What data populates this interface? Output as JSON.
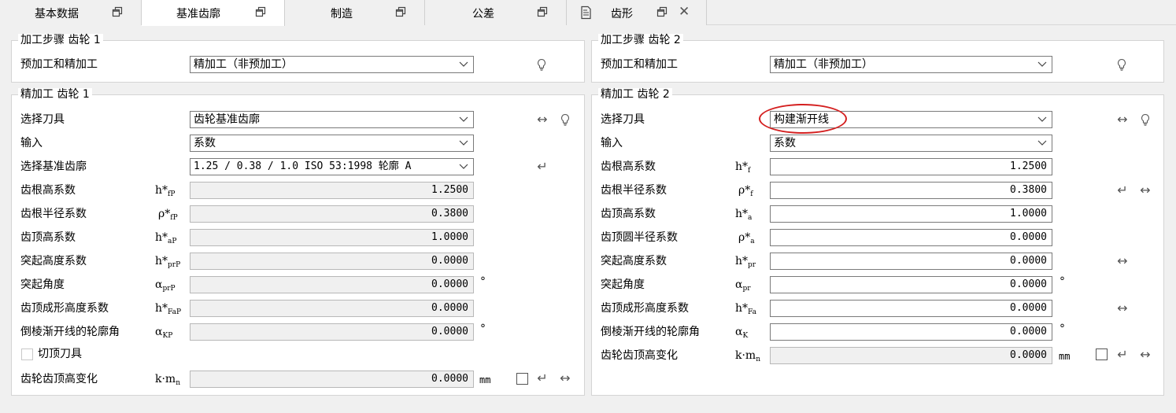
{
  "tabs": [
    {
      "label": "基本数据"
    },
    {
      "label": "基准齿廓"
    },
    {
      "label": "制造"
    },
    {
      "label": "公差"
    },
    {
      "label": "齿形"
    }
  ],
  "left": {
    "step_title": "加工步骤 齿轮 1",
    "step_label": "预加工和精加工",
    "step_value": "精加工（非预加工）",
    "finish_title": "精加工 齿轮 1",
    "tool_label": "选择刀具",
    "tool_value": "齿轮基准齿廓",
    "input_label": "输入",
    "input_value": "系数",
    "profile_label": "选择基准齿廓",
    "profile_value": "1.25 / 0.38 / 1.0 ISO 53:1998 轮廓 A",
    "rows": [
      {
        "label": "齿根高系数",
        "sym": "h*",
        "sub": "fP",
        "value": "1.2500"
      },
      {
        "label": "齿根半径系数",
        "sym": "ρ*",
        "sub": "fP",
        "value": "0.3800"
      },
      {
        "label": "齿顶高系数",
        "sym": "h*",
        "sub": "aP",
        "value": "1.0000"
      },
      {
        "label": "突起高度系数",
        "sym": "h*",
        "sub": "prP",
        "value": "0.0000"
      },
      {
        "label": "突起角度",
        "sym": "α",
        "sub": "prP",
        "value": "0.0000"
      },
      {
        "label": "齿顶成形高度系数",
        "sym": "h*",
        "sub": "FaP",
        "value": "0.0000"
      },
      {
        "label": "倒棱渐开线的轮廓角",
        "sym": "α",
        "sub": "KP",
        "value": "0.0000"
      }
    ],
    "topping_label": "切顶刀具",
    "km_label": "齿轮齿顶高变化",
    "km_sym": "k·m",
    "km_sub": "n",
    "km_value": "0.0000",
    "km_unit": "mm",
    "deg_unit": "°"
  },
  "right": {
    "step_title": "加工步骤 齿轮 2",
    "step_label": "预加工和精加工",
    "step_value": "精加工（非预加工）",
    "finish_title": "精加工 齿轮 2",
    "tool_label": "选择刀具",
    "tool_value": "构建渐开线",
    "input_label": "输入",
    "input_value": "系数",
    "rows": [
      {
        "label": "齿根高系数",
        "sym": "h*",
        "sub": "f",
        "value": "1.2500"
      },
      {
        "label": "齿根半径系数",
        "sym": "ρ*",
        "sub": "f",
        "value": "0.3800"
      },
      {
        "label": "齿顶高系数",
        "sym": "h*",
        "sub": "a",
        "value": "1.0000"
      },
      {
        "label": "齿顶圆半径系数",
        "sym": "ρ*",
        "sub": "a",
        "value": "0.0000"
      },
      {
        "label": "突起高度系数",
        "sym": "h*",
        "sub": "pr",
        "value": "0.0000"
      },
      {
        "label": "突起角度",
        "sym": "α",
        "sub": "pr",
        "value": "0.0000"
      },
      {
        "label": "齿顶成形高度系数",
        "sym": "h*",
        "sub": "Fa",
        "value": "0.0000"
      },
      {
        "label": "倒棱渐开线的轮廓角",
        "sym": "α",
        "sub": "K",
        "value": "0.0000"
      }
    ],
    "km_label": "齿轮齿顶高变化",
    "km_sym": "k·m",
    "km_sub": "n",
    "km_value": "0.0000",
    "km_unit": "mm",
    "deg_unit": "°"
  },
  "icons": {
    "hint": "lightbulb-icon",
    "swap": "double-arrow-icon",
    "return": "return-arrow-icon",
    "restore": "window-restore-icon",
    "close": "close-icon",
    "document": "document-list-icon",
    "chevron": "chevron-down-icon"
  },
  "colors": {
    "highlight_ellipse": "#d42020",
    "readonly_field": "#f0f0f0"
  }
}
